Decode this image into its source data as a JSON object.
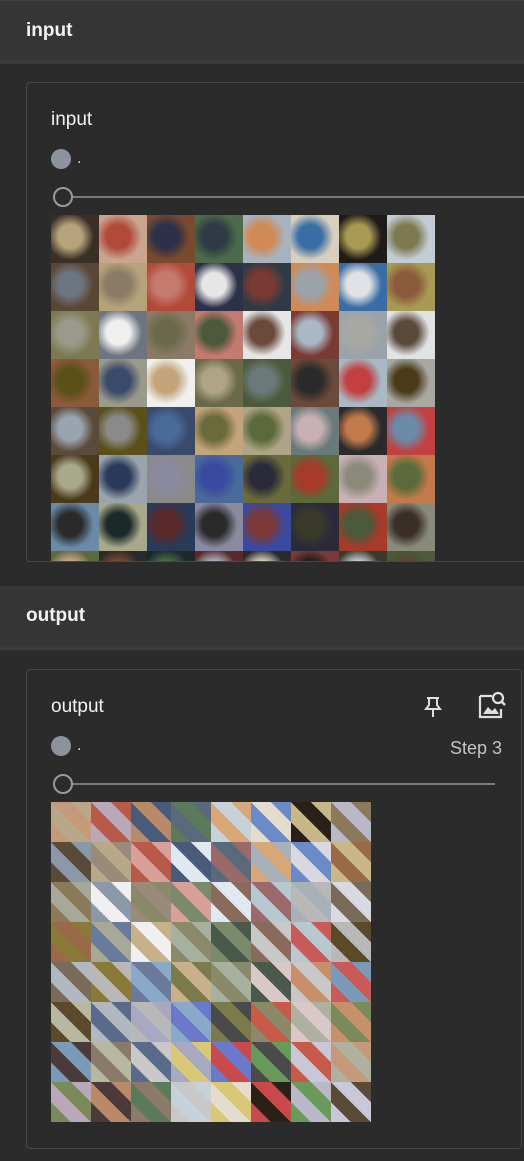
{
  "sections": [
    {
      "header": "input",
      "card": {
        "title": "input",
        "run_name": ".",
        "slider_value": 0
      }
    },
    {
      "header": "output",
      "card": {
        "title": "output",
        "run_name": ".",
        "step_label": "Step 3",
        "slider_value": 0
      }
    }
  ],
  "icons": {
    "pin": "pin-icon",
    "image_search": "image-search-icon"
  },
  "colors": {
    "background": "#2b2b2b",
    "header": "#353535",
    "run_dot": "#8d939c"
  },
  "input_grid_palette": [
    "#3a2f27",
    "#c9a58f",
    "#7a4a2e",
    "#4c6b4a",
    "#a7b3bf",
    "#d8cfbf",
    "#1f1b18",
    "#c3ccd5",
    "#5a4634",
    "#b7a37b",
    "#b24a3a",
    "#2c3048",
    "#2f3a44",
    "#d08a55",
    "#3a6da5",
    "#a89a52",
    "#7d7a52",
    "#6d7680",
    "#8a7a66",
    "#c57a70",
    "#e6e6e6",
    "#7a3a34",
    "#9aa3aa",
    "#e0e2e4",
    "#8a5a3a",
    "#9a9a8a",
    "#f0f0ef",
    "#6a6a4a",
    "#4a5a3a",
    "#6a4a3a",
    "#a8b8c4",
    "#a8a8a2",
    "#5a4a3a",
    "#5a5018",
    "#3a4a6a",
    "#c4a47a",
    "#b0a488",
    "#6a7a7a",
    "#2a2a2a",
    "#c24040",
    "#4a3a1a",
    "#9aa4ae",
    "#8a8a8a",
    "#4a6a9a",
    "#6a6a3a",
    "#5a6a3a",
    "#c8b0b4",
    "#c27a4a",
    "#6a8aa8",
    "#a8a88a",
    "#2a3a5a",
    "#8a8aa0",
    "#3a4aa0",
    "#2a2a3a",
    "#a83a2a",
    "#8a8a7a",
    "#5a6a3a",
    "#2a2a2a",
    "#1a2a2a",
    "#5a2a2a",
    "#2a2a2a",
    "#7a3a3a",
    "#3a3a2a",
    "#4a5a3a"
  ],
  "output_grid_palette": [
    "#c49a7a",
    "#b8a8b8",
    "#b88a6a",
    "#5a7a5a",
    "#c8d0d8",
    "#e4dccc",
    "#2a2018",
    "#b8b8c8",
    "#5a4a38",
    "#b8a888",
    "#b85a4a",
    "#4a5a7a",
    "#5a6a7a",
    "#d8a878",
    "#6a8ac8",
    "#c8b888",
    "#8a7a5a",
    "#8a98a8",
    "#9a8a7a",
    "#d8a098",
    "#e0e8f0",
    "#9a6a6a",
    "#a8b0b8",
    "#d8d8e0",
    "#9a6a48",
    "#a8a898",
    "#f0f0f0",
    "#8a8a6a",
    "#7a8a6a",
    "#8a6a5a",
    "#b8c8d0",
    "#b8b8b8",
    "#7a6a58",
    "#8a7a38",
    "#6a7a9a",
    "#c8b08a",
    "#a8b0a0",
    "#4a5a4a",
    "#c8c8c8",
    "#c85a5a",
    "#5a4a2a",
    "#b0b8c0",
    "#b8b8b8",
    "#8aa8c8",
    "#7a7a4a",
    "#8a8a6a",
    "#d8c8c8",
    "#c8906a",
    "#7a9ab8",
    "#b8b8a0",
    "#5a6a8a",
    "#a8a8c0",
    "#6a7ac8",
    "#4a4a4a",
    "#c85a4a",
    "#b0b0a0",
    "#7a8a5a",
    "#4a3a3a",
    "#8a7a6a",
    "#c8c8c8",
    "#d8c878",
    "#c84a4a",
    "#6a9a5a",
    "#c8c8d8"
  ]
}
